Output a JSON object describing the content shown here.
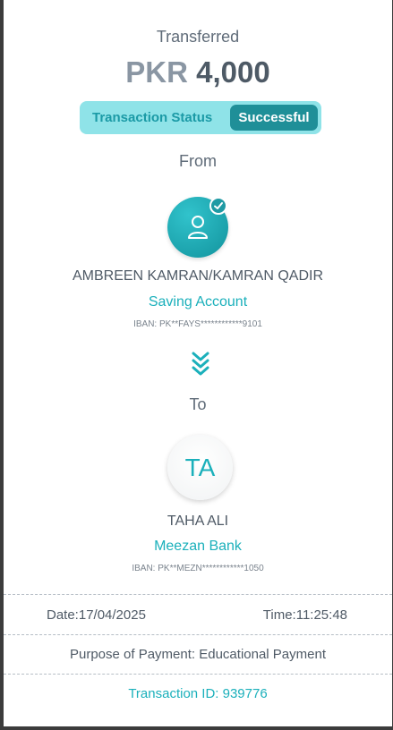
{
  "receipt": {
    "title": "Transferred",
    "currency": "PKR",
    "amount": "4,000",
    "status_label": "Transaction Status",
    "status_value": "Successful",
    "from_label": "From",
    "to_label": "To"
  },
  "sender": {
    "name": "AMBREEN KAMRAN/KAMRAN QADIR",
    "account_type": "Saving Account",
    "iban": "IBAN: PK**FAYS************9101"
  },
  "receiver": {
    "initials": "TA",
    "name": "TAHA ALI",
    "bank": "Meezan Bank",
    "iban": "IBAN: PK**MEZN************1050"
  },
  "details": {
    "date": "Date:17/04/2025",
    "time": "Time:11:25:48",
    "purpose": "Purpose of Payment: Educational Payment",
    "transaction_id": "Transaction ID: 939776"
  },
  "colors": {
    "accent": "#1bb0bb",
    "status_bg": "#8fe3e8",
    "status_badge": "#1f8f98"
  }
}
